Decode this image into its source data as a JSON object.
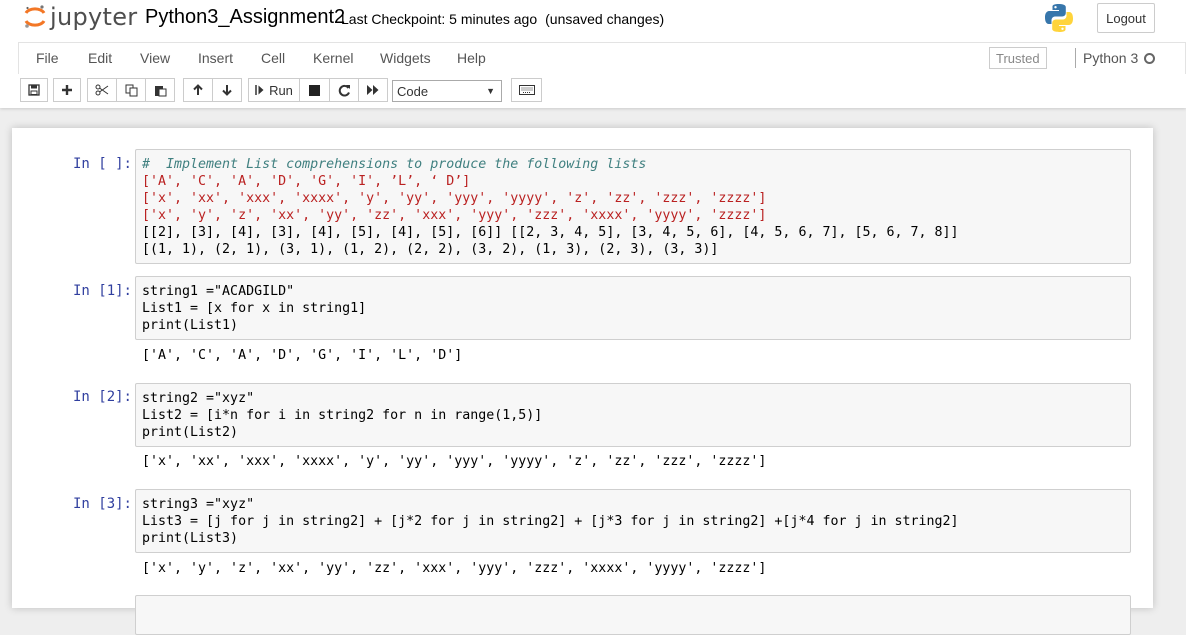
{
  "header": {
    "logo_text": "jupyter",
    "notebook_name": "Python3_Assignment2",
    "checkpoint": "Last Checkpoint: 5 minutes ago",
    "save_status": "(unsaved changes)",
    "logout_label": "Logout"
  },
  "menubar": {
    "items": [
      "File",
      "Edit",
      "View",
      "Insert",
      "Cell",
      "Kernel",
      "Widgets",
      "Help"
    ],
    "trusted_label": "Trusted",
    "kernel_name": "Python 3"
  },
  "toolbar": {
    "run_label": "Run",
    "cell_type": "Code",
    "icons": [
      "save-icon",
      "plus-icon",
      "cut-icon",
      "copy-icon",
      "paste-icon",
      "arrow-up-icon",
      "arrow-down-icon",
      "run-icon",
      "stop-icon",
      "restart-icon",
      "fast-forward-icon",
      "keyboard-icon"
    ]
  },
  "colors": {
    "prompt": "#303f9f",
    "comment": "#408080",
    "string": "#ba2121",
    "keyword": "#008000",
    "operator": "#aa22ff",
    "jupyter_orange": "#f37726"
  },
  "cells": [
    {
      "prompt": "In [ ]:",
      "lines": [
        "#  Implement List comprehensions to produce the following lists",
        "['A', 'C', 'A', 'D', 'G', 'I', ’L’, ‘ D’]",
        "['x', 'xx', 'xxx', 'xxxx', 'y', 'yy', 'yyy', 'yyyy', 'z', 'zz', 'zzz', 'zzzz']",
        "['x', 'y', 'z', 'xx', 'yy', 'zz', 'xxx', 'yyy', 'zzz', 'xxxx', 'yyyy', 'zzzz']",
        "[[2], [3], [4], [3], [4], [5], [4], [5], [6]] [[2, 3, 4, 5], [3, 4, 5, 6], [4, 5, 6, 7], [5, 6, 7, 8]]",
        "[(1, 1), (2, 1), (3, 1), (1, 2), (2, 2), (3, 2), (1, 3), (2, 3), (3, 3)]"
      ],
      "output": ""
    },
    {
      "prompt": "In [1]:",
      "lines": [
        "string1 =\"ACADGILD\"",
        "List1 = [x for x in string1]",
        "print(List1)"
      ],
      "output": "['A', 'C', 'A', 'D', 'G', 'I', 'L', 'D']"
    },
    {
      "prompt": "In [2]:",
      "lines": [
        "string2 =\"xyz\"",
        "List2 = [i*n for i in string2 for n in range(1,5)]",
        "print(List2)"
      ],
      "output": "['x', 'xx', 'xxx', 'xxxx', 'y', 'yy', 'yyy', 'yyyy', 'z', 'zz', 'zzz', 'zzzz']"
    },
    {
      "prompt": "In [3]:",
      "lines": [
        "string3 =\"xyz\"",
        "List3 = [j for j in string2] + [j*2 for j in string2] + [j*3 for j in string2] +[j*4 for j in string2]",
        "print(List3)"
      ],
      "output": "['x', 'y', 'z', 'xx', 'yy', 'zz', 'xxx', 'yyy', 'zzz', 'xxxx', 'yyyy', 'zzzz']"
    }
  ]
}
